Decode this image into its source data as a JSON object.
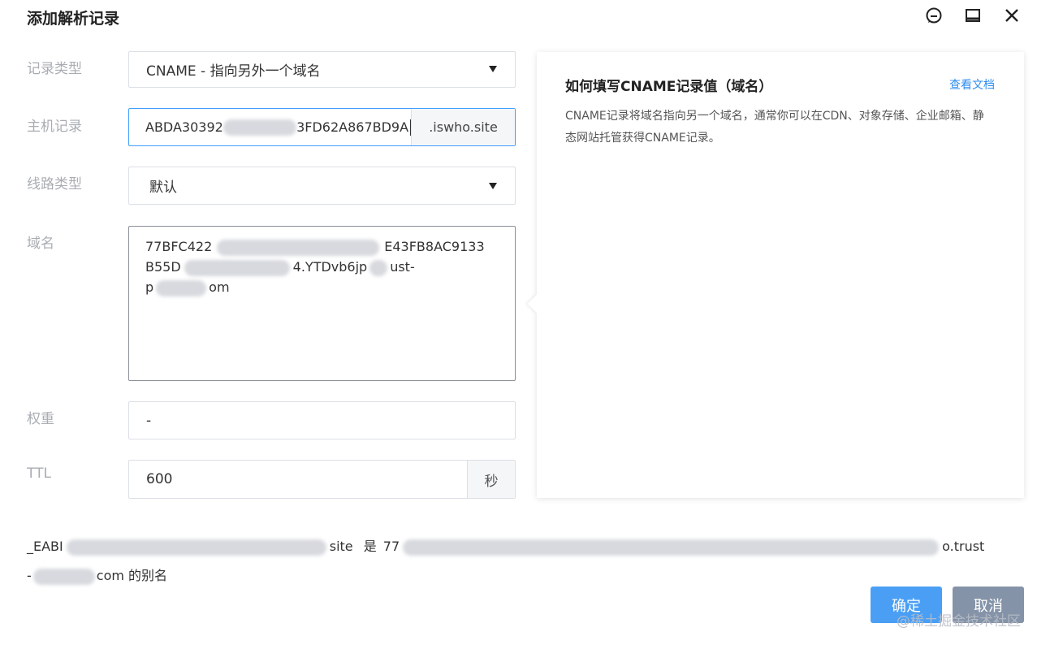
{
  "dialog": {
    "title": "添加解析记录",
    "icons": [
      "feedback-icon",
      "minimize-icon",
      "close-icon"
    ]
  },
  "form": {
    "record_type": {
      "label": "记录类型",
      "value": "CNAME - 指向另外一个域名"
    },
    "host": {
      "label": "主机记录",
      "value_prefix": "ABDA30392",
      "value_suffix": "3FD62A867BD9A",
      "domain_suffix": ".iswho.site"
    },
    "line_type": {
      "label": "线路类型",
      "value": "默认"
    },
    "domain": {
      "label": "域名",
      "line1": "77BFC422",
      "line1_end": "E43FB8AC9133",
      "line2_start": "B55D",
      "line2_end": "4.YTDvb6jp",
      "line2_tail": "ust-",
      "line3_start": "p",
      "line3_end": "om"
    },
    "weight": {
      "label": "权重",
      "value": "-"
    },
    "ttl": {
      "label": "TTL",
      "value": "600",
      "unit": "秒"
    }
  },
  "help": {
    "title": "如何填写CNAME记录值（域名）",
    "doc_link": "查看文档",
    "description": "CNAME记录将域名指向另一个域名，通常你可以在CDN、对象存储、企业邮箱、静态网站托管获得CNAME记录。"
  },
  "summary": {
    "part1": "_EABI",
    "part2": "site",
    "middle": "是",
    "part3": "77",
    "part4": "o.trust",
    "part5": "-",
    "part6": "com 的别名"
  },
  "buttons": {
    "ok": "确定",
    "cancel": "取消"
  },
  "watermark": "@稀土掘金技术社区",
  "colors": {
    "primary": "#4a9ff5",
    "cancel": "#8493a8",
    "link": "#2f8cf0",
    "focus_border": "#409eff"
  }
}
